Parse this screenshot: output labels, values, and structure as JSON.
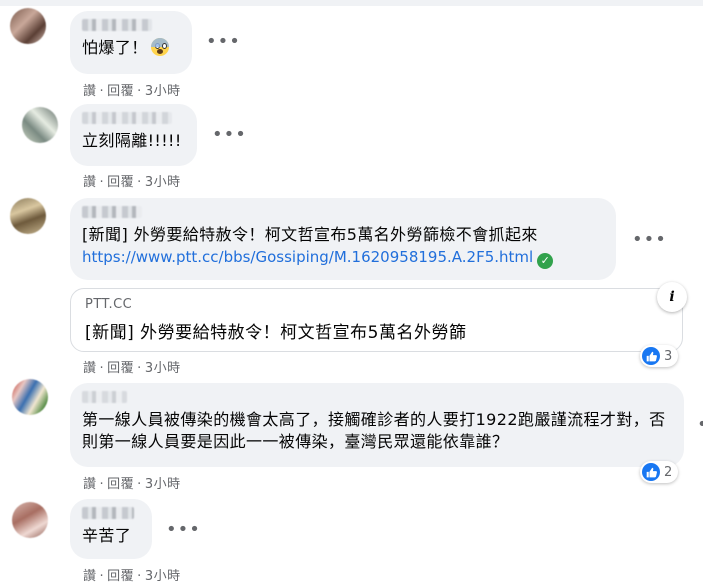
{
  "comments": [
    {
      "text": "怕爆了！",
      "emoji": "face-screaming-in-fear",
      "actions": {
        "like": "讚",
        "reply": "回覆",
        "time": "3小時"
      }
    },
    {
      "text": "立刻隔離!!!!!",
      "actions": {
        "like": "讚",
        "reply": "回覆",
        "time": "3小時"
      }
    },
    {
      "text": "[新聞] 外勞要給特赦令！柯文哲宣布5萬名外勞篩檢不會抓起來",
      "link": "https://www.ptt.cc/bbs/Gossiping/M.1620958195.A.2F5.html",
      "link_verified_icon": "check-circle-icon",
      "preview": {
        "domain": "PTT.CC",
        "title": "[新聞] 外勞要給特赦令！柯文哲宣布5萬名外勞篩",
        "info_label": "i"
      },
      "reactions": {
        "type": "like",
        "count": "3"
      },
      "actions": {
        "like": "讚",
        "reply": "回覆",
        "time": "3小時"
      }
    },
    {
      "text": "第一線人員被傳染的機會太高了，接觸確診者的人要打1922跑嚴謹流程才對，否則第一線人員要是因此一一被傳染，臺灣民眾還能依靠誰？",
      "reactions": {
        "type": "like",
        "count": "2"
      },
      "actions": {
        "like": "讚",
        "reply": "回覆",
        "time": "3小時"
      }
    },
    {
      "text": "辛苦了",
      "actions": {
        "like": "讚",
        "reply": "回覆",
        "time": "3小時"
      }
    }
  ],
  "more_options_glyph": "•••",
  "colors": {
    "bubble": "#f0f2f5",
    "link": "#216fdb",
    "meta": "#65676b",
    "like": "#1877f2"
  }
}
